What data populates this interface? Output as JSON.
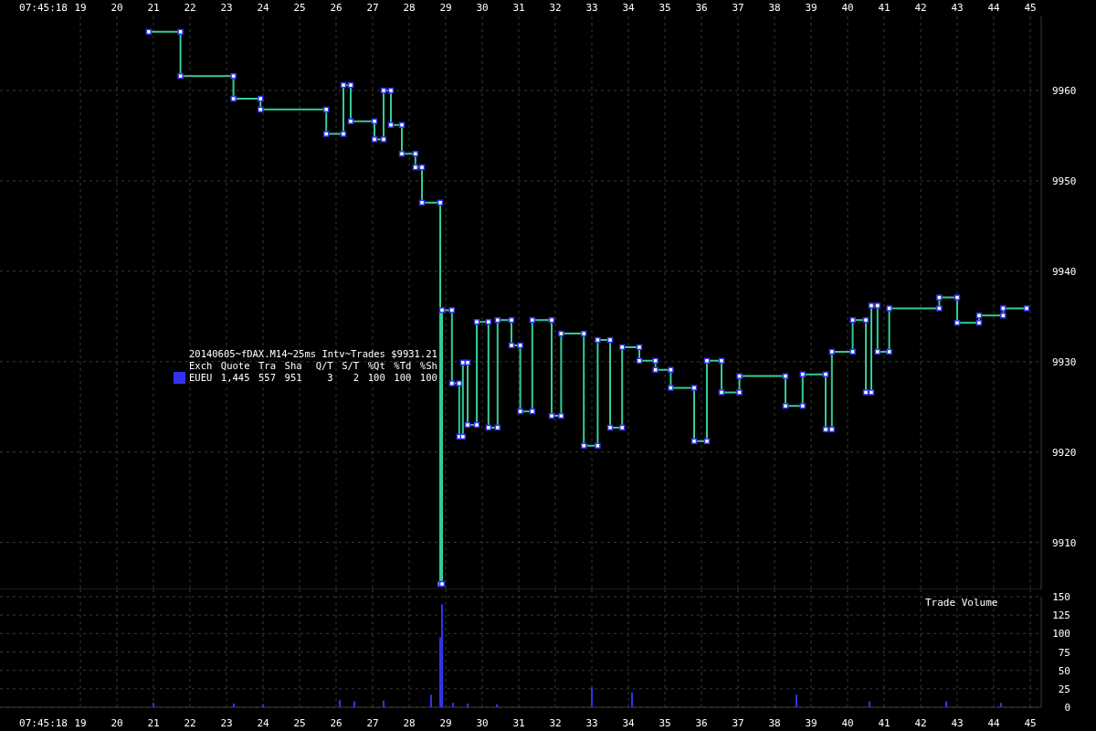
{
  "price_chart": {
    "time_label": "07:45:18",
    "chart_data": {
      "type": "line",
      "grid": true,
      "xlim": [
        16.8,
        45.3
      ],
      "ylim": [
        9904.8,
        9968.2
      ],
      "xticks": [
        19,
        20,
        21,
        22,
        23,
        24,
        25,
        26,
        27,
        28,
        29,
        30,
        31,
        32,
        33,
        34,
        35,
        36,
        37,
        38,
        39,
        40,
        41,
        42,
        43,
        44,
        45
      ],
      "yticks": [
        9910,
        9920,
        9930,
        9940,
        9950,
        9960
      ],
      "x": [
        20.87,
        21.74,
        21.74,
        23.19,
        23.19,
        23.93,
        23.93,
        25.73,
        25.73,
        26.2,
        26.2,
        26.4,
        26.4,
        27.05,
        27.05,
        27.3,
        27.3,
        27.5,
        27.5,
        27.8,
        27.8,
        28.17,
        28.17,
        28.35,
        28.35,
        28.85,
        28.85,
        28.9,
        28.9,
        29.17,
        29.17,
        29.37,
        29.37,
        29.47,
        29.47,
        29.6,
        29.6,
        29.85,
        29.85,
        30.17,
        30.17,
        30.42,
        30.42,
        30.8,
        30.8,
        31.04,
        31.04,
        31.37,
        31.37,
        31.9,
        31.9,
        32.16,
        32.16,
        32.78,
        32.78,
        33.16,
        33.16,
        33.5,
        33.5,
        33.83,
        33.83,
        34.3,
        34.3,
        34.74,
        34.74,
        35.16,
        35.16,
        35.8,
        35.8,
        36.15,
        36.15,
        36.55,
        36.55,
        37.04,
        37.04,
        38.3,
        38.3,
        38.77,
        38.77,
        39.4,
        39.4,
        39.57,
        39.57,
        40.14,
        40.14,
        40.5,
        40.5,
        40.65,
        40.65,
        40.82,
        40.82,
        41.14,
        41.14,
        42.51,
        42.51,
        43.0,
        43.0,
        43.6,
        43.6,
        44.26,
        44.26,
        44.9
      ],
      "series": [
        {
          "color": "#33cc99",
          "marker": "square",
          "values": [
            9966.5,
            9966.5,
            9961.6,
            9961.6,
            9959.1,
            9959.1,
            9957.9,
            9957.9,
            9955.2,
            9955.2,
            9960.6,
            9960.6,
            9956.6,
            9956.6,
            9954.6,
            9954.6,
            9960,
            9960,
            9956.2,
            9956.2,
            9953,
            9953,
            9951.5,
            9951.5,
            9947.6,
            9947.6,
            9905.4,
            9905.4,
            9935.7,
            9935.7,
            9927.6,
            9927.6,
            9921.7,
            9921.7,
            9929.9,
            9929.9,
            9923,
            9923,
            9934.4,
            9934.4,
            9922.7,
            9922.7,
            9934.6,
            9934.6,
            9931.8,
            9931.8,
            9924.5,
            9924.5,
            9934.6,
            9934.6,
            9924,
            9924,
            9933.1,
            9933.1,
            9920.7,
            9920.7,
            9932.4,
            9932.4,
            9922.7,
            9922.7,
            9931.6,
            9931.6,
            9930.1,
            9930.1,
            9929.1,
            9929.1,
            9927.1,
            9927.1,
            9921.2,
            9921.2,
            9930.1,
            9930.1,
            9926.6,
            9926.6,
            9928.4,
            9928.4,
            9925.1,
            9925.1,
            9928.6,
            9928.6,
            9922.5,
            9922.5,
            9931.1,
            9931.1,
            9934.6,
            9934.6,
            9926.6,
            9926.6,
            9936.2,
            9936.2,
            9931.1,
            9931.1,
            9935.9,
            9935.9,
            9937.1,
            9937.1,
            9934.3,
            9934.3,
            9935.1,
            9935.1,
            9935.9,
            9935.9
          ]
        }
      ]
    }
  },
  "legend": {
    "title": "20140605~fDAX.M14~25ms Intv~Trades $9931.21",
    "columns": [
      "Exch",
      "Quote",
      "Tra",
      "Sha",
      "Q/T",
      "S/T",
      "%Qt",
      "%Td",
      "%Sh"
    ],
    "rows": [
      {
        "color": "#3333ee",
        "cells": [
          "EUEU",
          "1,445",
          "557",
          "951",
          "3",
          "2",
          "100",
          "100",
          "100"
        ]
      }
    ]
  },
  "volume_chart": {
    "time_label": "07:45:18",
    "chart_data": {
      "type": "bar",
      "title": "Trade Volume",
      "grid": true,
      "xlim": [
        16.8,
        45.3
      ],
      "ylim": [
        0,
        150
      ],
      "xticks": [
        19,
        20,
        21,
        22,
        23,
        24,
        25,
        26,
        27,
        28,
        29,
        30,
        31,
        32,
        33,
        34,
        35,
        36,
        37,
        38,
        39,
        40,
        41,
        42,
        43,
        44,
        45
      ],
      "yticks": [
        0,
        25,
        50,
        75,
        100,
        125,
        150
      ],
      "x": [
        21.0,
        23.2,
        24.0,
        26.1,
        26.5,
        27.3,
        28.6,
        28.85,
        28.9,
        29.2,
        29.6,
        30.4,
        33.0,
        34.1,
        38.6,
        40.6,
        42.7,
        44.2
      ],
      "series": [
        {
          "color": "#3333ee",
          "values": [
            6,
            5,
            4,
            10,
            8,
            9,
            17,
            95,
            140,
            6,
            5,
            4,
            27,
            20,
            17,
            8,
            8,
            6
          ]
        }
      ]
    }
  }
}
